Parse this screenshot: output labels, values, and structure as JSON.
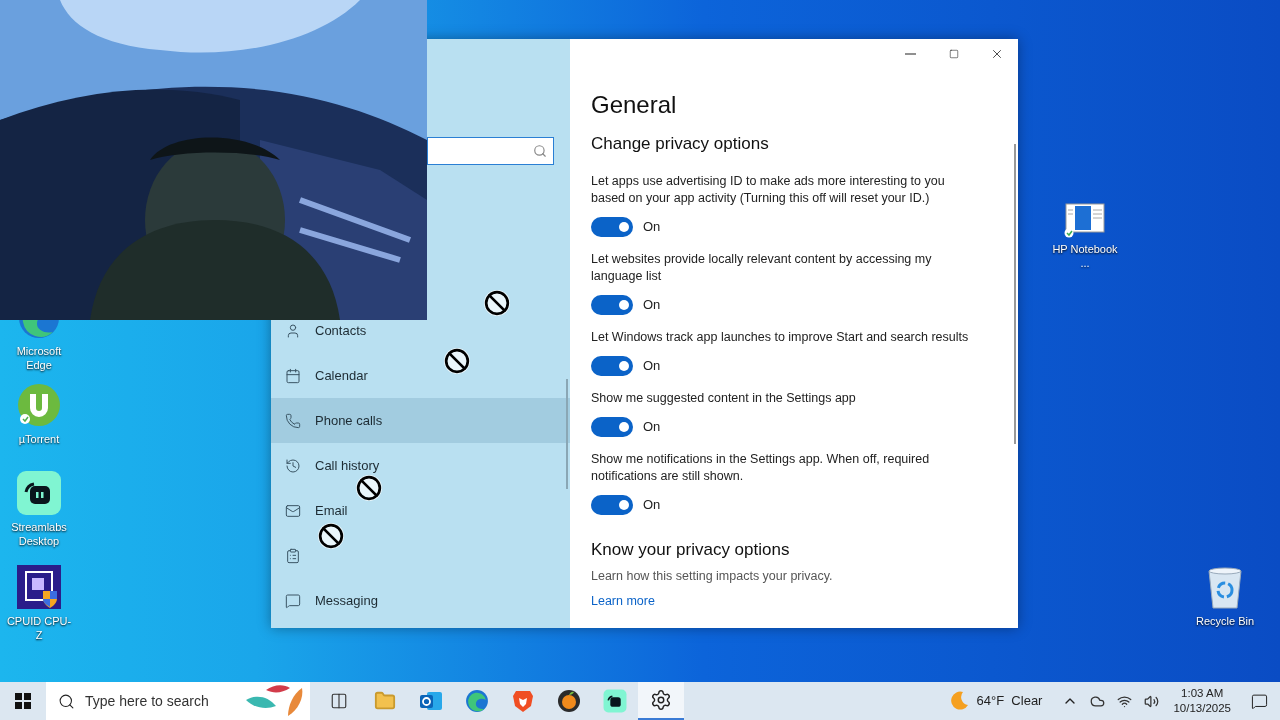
{
  "desktop": {
    "icons": [
      {
        "label": "Microsoft Edge",
        "kind": "edge"
      },
      {
        "label": "µTorrent",
        "kind": "utorrent"
      },
      {
        "label": "Streamlabs Desktop",
        "kind": "streamlabs"
      },
      {
        "label": "CPUID CPU-Z",
        "kind": "cpuz"
      },
      {
        "label": "HP Notebook ...",
        "kind": "document"
      },
      {
        "label": "Recycle Bin",
        "kind": "recycle"
      }
    ]
  },
  "settings_window": {
    "sidebar": {
      "items": [
        {
          "label": "Contacts",
          "kind": "person",
          "selected": false
        },
        {
          "label": "Calendar",
          "kind": "calendar",
          "selected": false
        },
        {
          "label": "Phone calls",
          "kind": "phone",
          "selected": true
        },
        {
          "label": "Call history",
          "kind": "history",
          "selected": false
        },
        {
          "label": "Email",
          "kind": "mail",
          "selected": false
        },
        {
          "kind": "tasks",
          "selected": false
        },
        {
          "label": "Messaging",
          "kind": "message",
          "selected": false
        }
      ]
    },
    "page": {
      "title": "General",
      "section": "Change privacy options",
      "settings": [
        {
          "description": "Let apps use advertising ID to make ads more interesting to you based on your app activity (Turning this off will reset your ID.)",
          "on": true,
          "state_label": "On"
        },
        {
          "description": "Let websites provide locally relevant content by accessing my language list",
          "on": true,
          "state_label": "On"
        },
        {
          "description": "Let Windows track app launches to improve Start and search results",
          "on": true,
          "state_label": "On"
        },
        {
          "description": "Show me suggested content in the Settings app",
          "on": true,
          "state_label": "On"
        },
        {
          "description": "Show me notifications in the Settings app. When off, required notifications are still shown.",
          "on": true,
          "state_label": "On"
        }
      ],
      "section_2": "Know your privacy options",
      "section_2_text": "Learn how this setting impacts your privacy.",
      "link": "Learn more"
    }
  },
  "taskbar": {
    "search_placeholder": "Type here to search",
    "apps": [
      {
        "kind": "task-view",
        "selected": false
      },
      {
        "kind": "folder",
        "selected": false
      },
      {
        "kind": "outlook",
        "selected": false
      },
      {
        "kind": "edge",
        "selected": false
      },
      {
        "kind": "brave",
        "selected": false
      },
      {
        "kind": "fl",
        "selected": false
      },
      {
        "kind": "streamlabs",
        "selected": false
      },
      {
        "kind": "settings",
        "selected": true
      }
    ],
    "weather": "64°F  Clear",
    "time": "1:03 AM",
    "date": "10/13/2025"
  }
}
